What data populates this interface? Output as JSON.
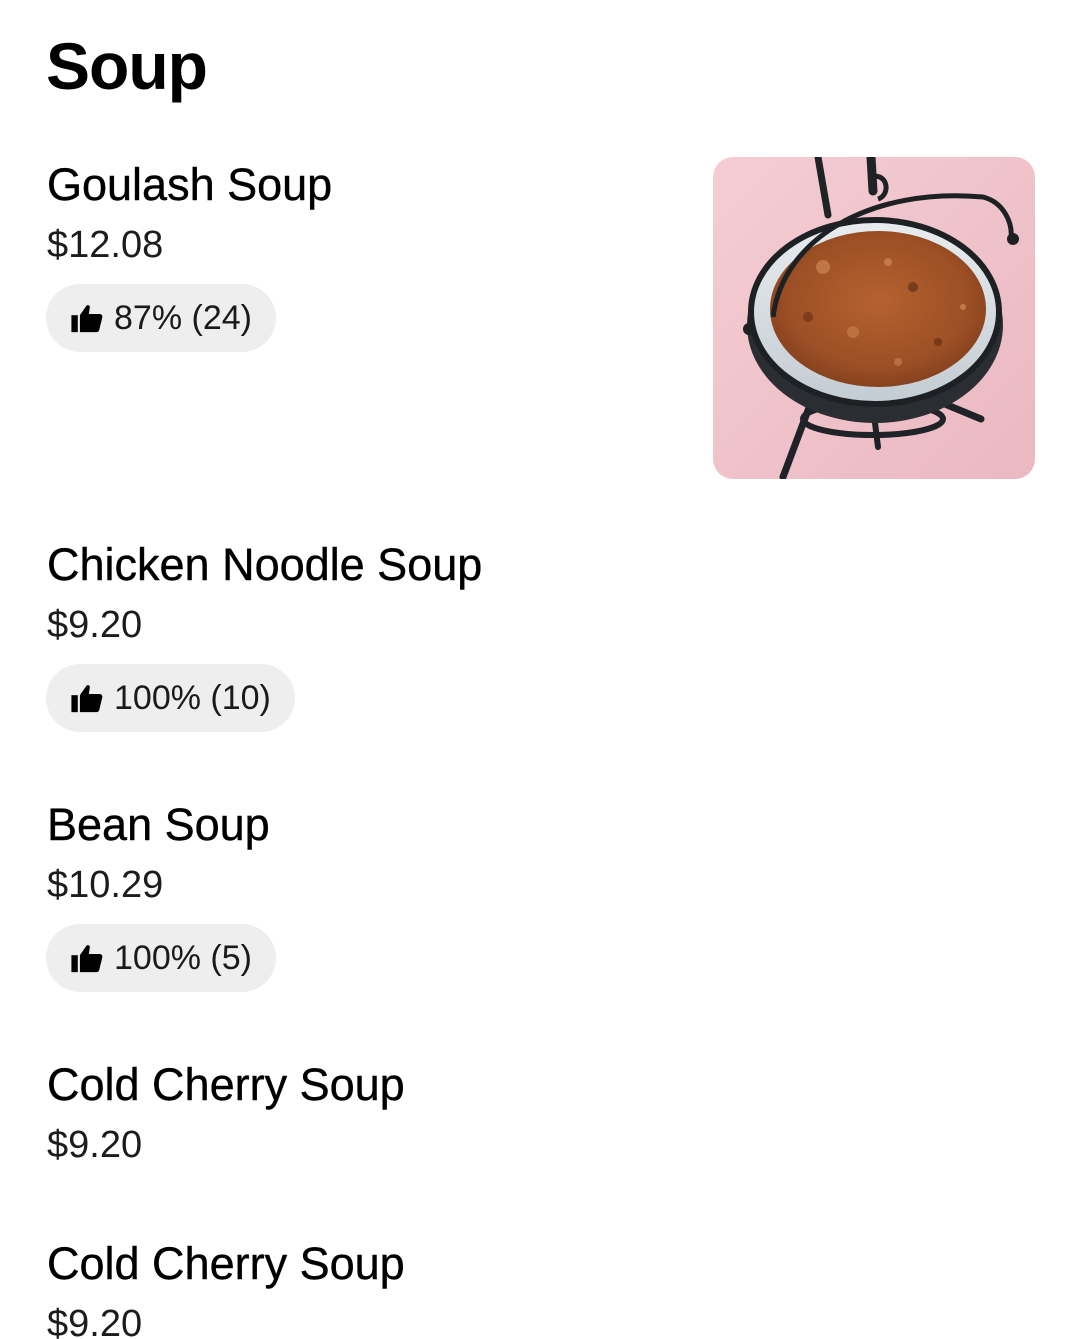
{
  "section": {
    "title": "Soup"
  },
  "items": [
    {
      "name": "Goulash Soup",
      "price": "$12.08",
      "rating": "87% (24)",
      "has_photo": true,
      "photo_icon": "soup-bowl-image"
    },
    {
      "name": "Chicken Noodle Soup",
      "price": "$9.20",
      "rating": "100% (10)"
    },
    {
      "name": "Bean Soup",
      "price": "$10.29",
      "rating": "100% (5)"
    },
    {
      "name": "Cold Cherry Soup",
      "price": "$9.20"
    },
    {
      "name": "Cold Cherry Soup",
      "price": "$9.20"
    }
  ],
  "icons": {
    "rating": "thumbs-up-icon"
  },
  "colors": {
    "pill_background": "#eeeeee",
    "text": "#000000",
    "photo_background": "#f2c4cc",
    "soup": "#a4552c"
  }
}
